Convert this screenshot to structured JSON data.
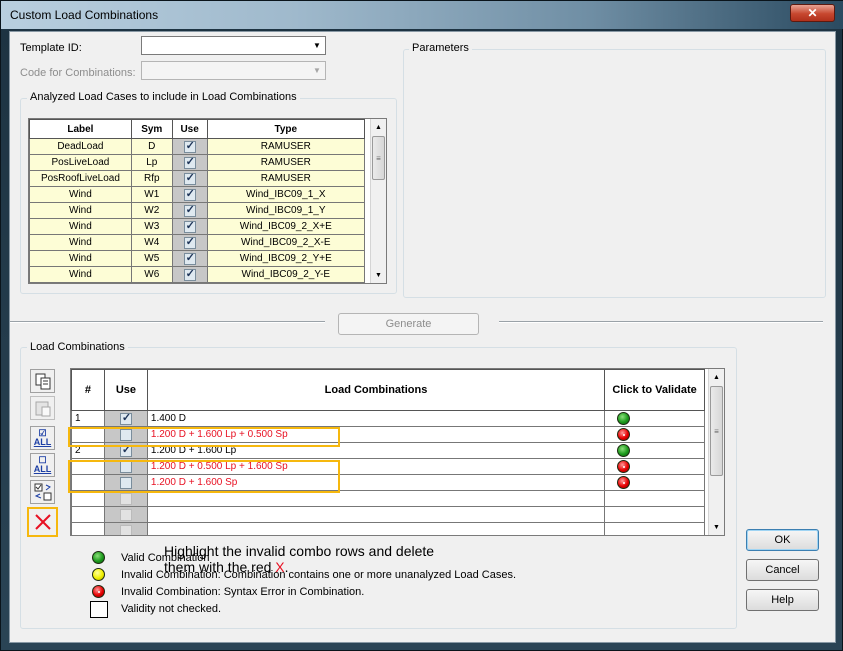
{
  "window": {
    "title": "Custom Load Combinations",
    "close_label": "✕"
  },
  "template": {
    "label": "Template ID:",
    "value": ""
  },
  "code": {
    "label": "Code for Combinations:",
    "value": ""
  },
  "parameters": {
    "title": "Parameters"
  },
  "analyzed": {
    "title": "Analyzed Load Cases to include in Load Combinations",
    "columns": [
      "Label",
      "Sym",
      "Use",
      "Type"
    ],
    "rows": [
      {
        "label": "DeadLoad",
        "sym": "D",
        "use": true,
        "type": "RAMUSER"
      },
      {
        "label": "PosLiveLoad",
        "sym": "Lp",
        "use": true,
        "type": "RAMUSER"
      },
      {
        "label": "PosRoofLiveLoad",
        "sym": "Rfp",
        "use": true,
        "type": "RAMUSER"
      },
      {
        "label": "Wind",
        "sym": "W1",
        "use": true,
        "type": "Wind_IBC09_1_X"
      },
      {
        "label": "Wind",
        "sym": "W2",
        "use": true,
        "type": "Wind_IBC09_1_Y"
      },
      {
        "label": "Wind",
        "sym": "W3",
        "use": true,
        "type": "Wind_IBC09_2_X+E"
      },
      {
        "label": "Wind",
        "sym": "W4",
        "use": true,
        "type": "Wind_IBC09_2_X-E"
      },
      {
        "label": "Wind",
        "sym": "W5",
        "use": true,
        "type": "Wind_IBC09_2_Y+E"
      },
      {
        "label": "Wind",
        "sym": "W6",
        "use": true,
        "type": "Wind_IBC09_2_Y-E"
      }
    ]
  },
  "generate_label": "Generate",
  "combos": {
    "title": "Load Combinations",
    "columns": {
      "num": "#",
      "use": "Use",
      "combo": "Load Combinations",
      "validate": "Click to Validate"
    },
    "rows": [
      {
        "num": "1",
        "use": true,
        "text": "1.400 D",
        "invalid": false,
        "status": "valid"
      },
      {
        "num": "",
        "use": false,
        "text": "1.200 D + 1.600 Lp + 0.500 Sp",
        "invalid": true,
        "status": "syntax-error"
      },
      {
        "num": "2",
        "use": true,
        "text": "1.200 D + 1.600 Lp",
        "invalid": false,
        "status": "valid"
      },
      {
        "num": "",
        "use": false,
        "text": "1.200 D + 0.500 Lp + 1.600 Sp",
        "invalid": true,
        "status": "syntax-error"
      },
      {
        "num": "",
        "use": false,
        "text": "1.200 D + 1.600 Sp",
        "invalid": true,
        "status": "syntax-error"
      },
      {
        "num": "",
        "use": null,
        "text": "",
        "invalid": false,
        "status": ""
      },
      {
        "num": "",
        "use": null,
        "text": "",
        "invalid": false,
        "status": ""
      },
      {
        "num": "",
        "use": null,
        "text": "",
        "invalid": false,
        "status": ""
      }
    ]
  },
  "tools": {
    "all_label_1": "ALL",
    "all_label_2": "ALL"
  },
  "instruction": {
    "line1": "Highlight the invalid combo rows and delete",
    "line2_prefix": "them with the red ",
    "line2_x": "X",
    "line2_suffix": "."
  },
  "legend": [
    {
      "status": "valid",
      "text": "Valid Combination"
    },
    {
      "status": "unanalyzed",
      "text": "Invalid Combination: Combination contains one or more unanalyzed Load Cases."
    },
    {
      "status": "syntax-error",
      "text": "Invalid Combination: Syntax Error in Combination."
    },
    {
      "status": "unchecked",
      "text": "Validity not checked."
    }
  ],
  "buttons": {
    "ok": "OK",
    "cancel": "Cancel",
    "help": "Help"
  },
  "colors": {
    "valid": "#1c9a1c",
    "syntax_error": "#e60000",
    "unanalyzed": "#f0f000",
    "highlight": "#f6b80e",
    "invalid_text": "#e81123"
  }
}
